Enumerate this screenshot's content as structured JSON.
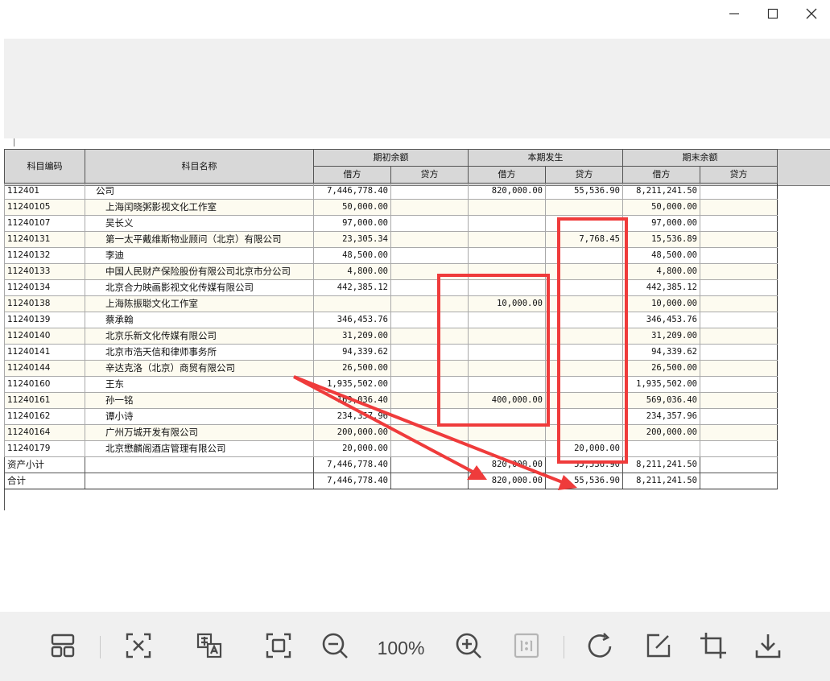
{
  "window": {
    "controls": [
      "minimize-icon",
      "maximize-icon",
      "close-icon"
    ]
  },
  "table": {
    "headers": {
      "code": "科目编码",
      "name": "科目名称",
      "opening": "期初余额",
      "period": "本期发生",
      "closing": "期末余额",
      "debit": "借方",
      "credit": "贷方"
    },
    "rows": [
      {
        "code": "112401",
        "name": "公司",
        "od": "7,446,778.40",
        "oc": "",
        "pd": "820,000.00",
        "pc": "55,536.90",
        "cd": "8,211,241.50",
        "cc": ""
      },
      {
        "code": "11240105",
        "name": "上海闰晓粥影视文化工作室",
        "od": "50,000.00",
        "oc": "",
        "pd": "",
        "pc": "",
        "cd": "50,000.00",
        "cc": ""
      },
      {
        "code": "11240107",
        "name": "吴长义",
        "od": "97,000.00",
        "oc": "",
        "pd": "",
        "pc": "",
        "cd": "97,000.00",
        "cc": ""
      },
      {
        "code": "11240131",
        "name": "第一太平戴维斯物业顾问（北京）有限公司",
        "od": "23,305.34",
        "oc": "",
        "pd": "",
        "pc": "7,768.45",
        "cd": "15,536.89",
        "cc": ""
      },
      {
        "code": "11240132",
        "name": "李迪",
        "od": "48,500.00",
        "oc": "",
        "pd": "",
        "pc": "",
        "cd": "48,500.00",
        "cc": ""
      },
      {
        "code": "11240133",
        "name": "中国人民财产保险股份有限公司北京市分公司",
        "od": "4,800.00",
        "oc": "",
        "pd": "",
        "pc": "",
        "cd": "4,800.00",
        "cc": ""
      },
      {
        "code": "11240134",
        "name": "北京合力映画影视文化传媒有限公司",
        "od": "442,385.12",
        "oc": "",
        "pd": "",
        "pc": "",
        "cd": "442,385.12",
        "cc": ""
      },
      {
        "code": "11240138",
        "name": "上海陈振聪文化工作室",
        "od": "",
        "oc": "",
        "pd": "10,000.00",
        "pc": "",
        "cd": "10,000.00",
        "cc": ""
      },
      {
        "code": "11240139",
        "name": "蔡承翰",
        "od": "346,453.76",
        "oc": "",
        "pd": "",
        "pc": "",
        "cd": "346,453.76",
        "cc": ""
      },
      {
        "code": "11240140",
        "name": "北京乐新文化传媒有限公司",
        "od": "31,209.00",
        "oc": "",
        "pd": "",
        "pc": "",
        "cd": "31,209.00",
        "cc": ""
      },
      {
        "code": "11240141",
        "name": "北京市浩天信和律师事务所",
        "od": "94,339.62",
        "oc": "",
        "pd": "",
        "pc": "",
        "cd": "94,339.62",
        "cc": ""
      },
      {
        "code": "11240144",
        "name": "辛达克洛（北京）商贸有限公司",
        "od": "26,500.00",
        "oc": "",
        "pd": "",
        "pc": "",
        "cd": "26,500.00",
        "cc": ""
      },
      {
        "code": "11240160",
        "name": "王东",
        "od": "1,935,502.00",
        "oc": "",
        "pd": "",
        "pc": "",
        "cd": "1,935,502.00",
        "cc": ""
      },
      {
        "code": "11240161",
        "name": "孙一铭",
        "od": "169,036.40",
        "oc": "",
        "pd": "400,000.00",
        "pc": "",
        "cd": "569,036.40",
        "cc": ""
      },
      {
        "code": "11240162",
        "name": "谭小诗",
        "od": "234,357.96",
        "oc": "",
        "pd": "",
        "pc": "",
        "cd": "234,357.96",
        "cc": ""
      },
      {
        "code": "11240164",
        "name": "广州万城开发有限公司",
        "od": "200,000.00",
        "oc": "",
        "pd": "",
        "pc": "",
        "cd": "200,000.00",
        "cc": ""
      },
      {
        "code": "11240179",
        "name": "北京懋麟阁酒店管理有限公司",
        "od": "20,000.00",
        "oc": "",
        "pd": "",
        "pc": "20,000.00",
        "cd": "",
        "cc": ""
      },
      {
        "code": "资产小计",
        "name": "",
        "od": "7,446,778.40",
        "oc": "",
        "pd": "820,000.00",
        "pc": "55,536.90",
        "cd": "8,211,241.50",
        "cc": ""
      },
      {
        "code": "合计",
        "name": "",
        "od": "7,446,778.40",
        "oc": "",
        "pd": "820,000.00",
        "pc": "55,536.90",
        "cd": "8,211,241.50",
        "cc": ""
      }
    ]
  },
  "annotations": {
    "color": "#ef3b3b",
    "marks": [
      "box-period-debit",
      "box-period-credit",
      "arrow-to-debit-total",
      "arrow-to-credit-total"
    ]
  },
  "toolbar": {
    "zoom_label": "100%",
    "icons": [
      "layout-icon",
      "ocr-scan-icon",
      "translate-icon",
      "fit-screen-icon",
      "zoom-out-icon",
      "zoom-in-icon",
      "actual-size-icon",
      "rotate-icon",
      "edit-icon",
      "crop-icon",
      "download-icon"
    ]
  }
}
